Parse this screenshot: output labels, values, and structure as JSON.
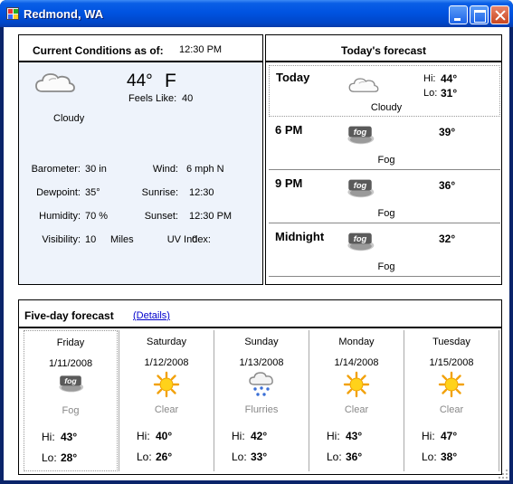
{
  "window": {
    "title": "Redmond, WA"
  },
  "current": {
    "header_label": "Current Conditions as of:",
    "time": "12:30 PM",
    "temperature": "44°",
    "unit": "F",
    "feels_like_label": "Feels Like:",
    "feels_like": "40",
    "condition": "Cloudy",
    "icon": "cloudy-icon",
    "details": [
      {
        "label": "Barometer:",
        "value": "30 in"
      },
      {
        "label": "Wind:",
        "value": "6 mph N"
      },
      {
        "label": "Dewpoint:",
        "value": "35°"
      },
      {
        "label": "Sunrise:",
        "value": "12:30"
      },
      {
        "label": "Humidity:",
        "value": "70 %"
      },
      {
        "label": "Sunset:",
        "value": "12:30 PM"
      },
      {
        "label": "Visibility:",
        "value": "10"
      },
      {
        "label": "Miles",
        "value": ""
      },
      {
        "label": "UV Index:",
        "value": "0"
      }
    ]
  },
  "today": {
    "header_label": "Today's forecast",
    "rows": [
      {
        "period": "Today",
        "condition": "Cloudy",
        "icon": "cloudy-icon",
        "hi_label": "Hi:",
        "hi": "44°",
        "lo_label": "Lo:",
        "lo": "31°"
      },
      {
        "period": "6 PM",
        "condition": "Fog",
        "icon": "fog-icon",
        "temp": "39°"
      },
      {
        "period": "9 PM",
        "condition": "Fog",
        "icon": "fog-icon",
        "temp": "36°"
      },
      {
        "period": "Midnight",
        "condition": "Fog",
        "icon": "fog-icon",
        "temp": "32°"
      }
    ]
  },
  "five_day": {
    "header_label": "Five-day forecast",
    "details_link": "(Details)",
    "hi_label": "Hi:",
    "lo_label": "Lo:",
    "days": [
      {
        "day": "Friday",
        "date": "1/11/2008",
        "condition": "Fog",
        "icon": "fog-icon",
        "hi": "43°",
        "lo": "28°"
      },
      {
        "day": "Saturday",
        "date": "1/12/2008",
        "condition": "Clear",
        "icon": "sun-icon",
        "hi": "40°",
        "lo": "26°"
      },
      {
        "day": "Sunday",
        "date": "1/13/2008",
        "condition": "Flurries",
        "icon": "snow-flurries-icon",
        "hi": "42°",
        "lo": "33°"
      },
      {
        "day": "Monday",
        "date": "1/14/2008",
        "condition": "Clear",
        "icon": "sun-icon",
        "hi": "43°",
        "lo": "36°"
      },
      {
        "day": "Tuesday",
        "date": "1/15/2008",
        "condition": "Clear",
        "icon": "sun-icon",
        "hi": "47°",
        "lo": "38°"
      }
    ]
  }
}
